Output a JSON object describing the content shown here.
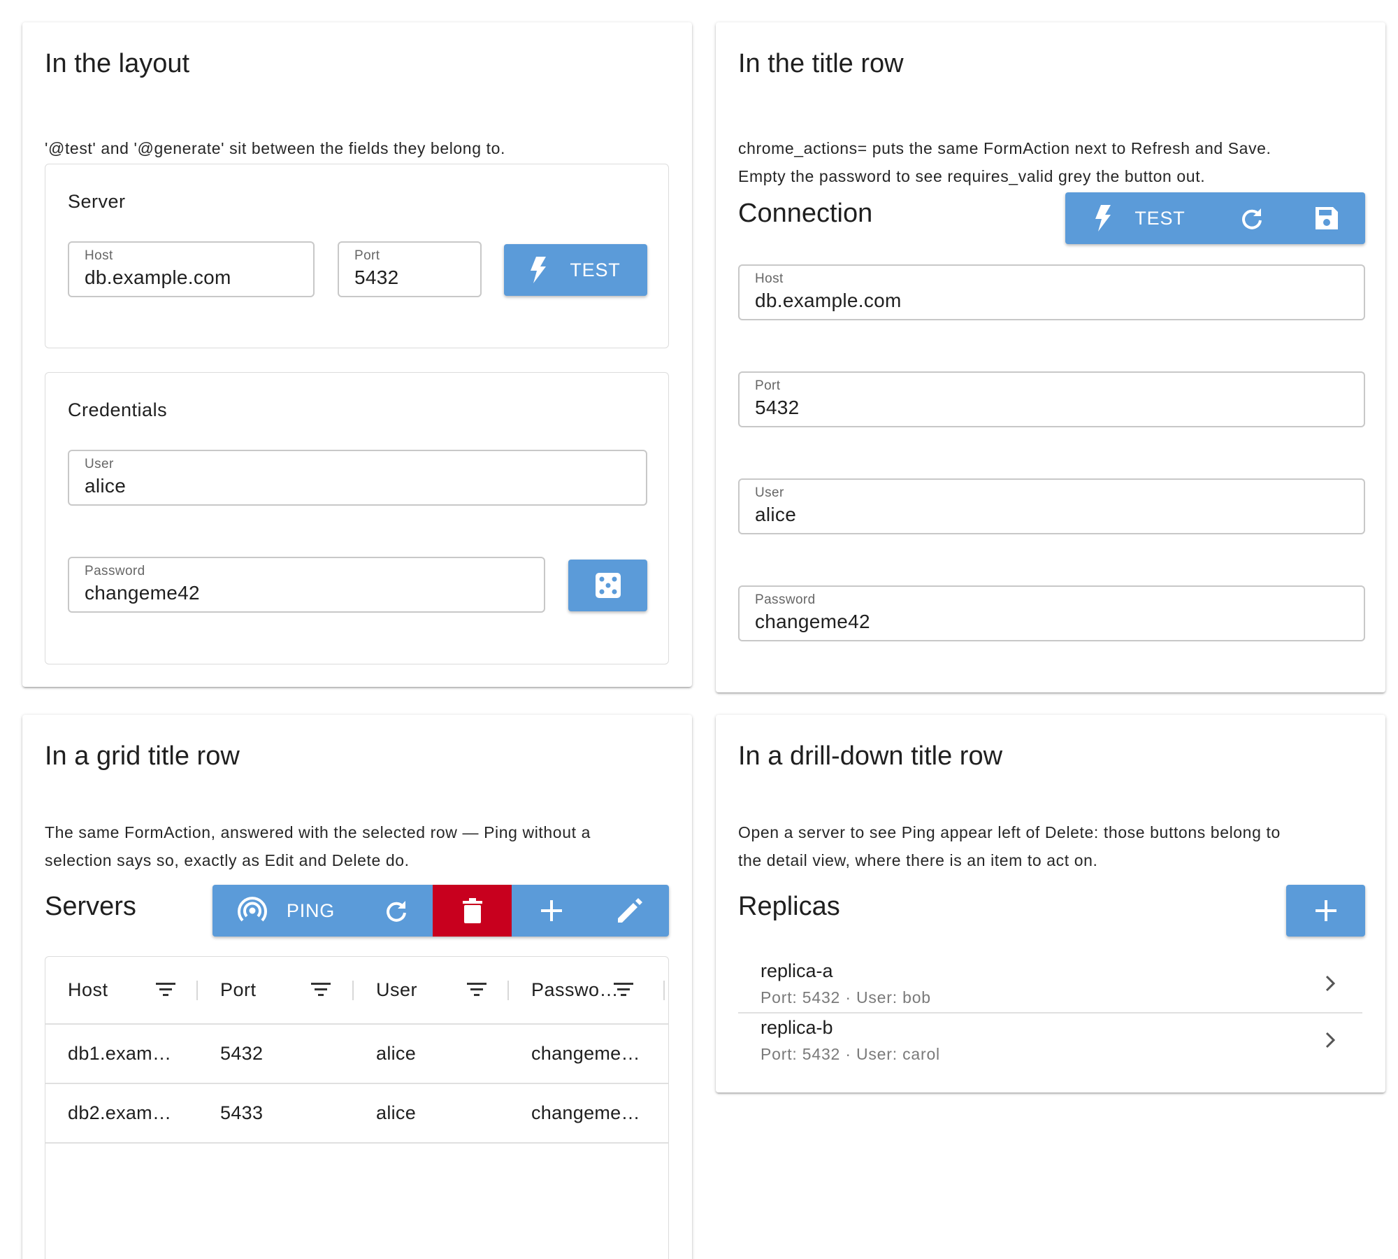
{
  "cards": {
    "layout": {
      "title": "In the layout",
      "desc": "'@test' and '@generate' sit between the fields they belong to.",
      "server": {
        "title": "Server",
        "host_label": "Host",
        "host_value": "db.example.com",
        "port_label": "Port",
        "port_value": "5432",
        "test_label": "TEST"
      },
      "credentials": {
        "title": "Credentials",
        "user_label": "User",
        "user_value": "alice",
        "password_label": "Password",
        "password_value": "changeme42"
      }
    },
    "titlerow": {
      "title": "In the title row",
      "desc1": "chrome_actions= puts the same FormAction next to Refresh and Save.",
      "desc2": "Empty the password to see requires_valid grey the button out.",
      "section": "Connection",
      "test_label": "TEST",
      "host_label": "Host",
      "host_value": "db.example.com",
      "port_label": "Port",
      "port_value": "5432",
      "user_label": "User",
      "user_value": "alice",
      "password_label": "Password",
      "password_value": "changeme42"
    },
    "grid": {
      "title": "In a grid title row",
      "desc1": "The same FormAction, answered with the selected row — Ping without a",
      "desc2": "selection says so, exactly as Edit and Delete do.",
      "section": "Servers",
      "ping_label": "PING",
      "columns": [
        "Host",
        "Port",
        "User",
        "Passwo…"
      ],
      "rows": [
        [
          "db1.exam…",
          "5432",
          "alice",
          "changeme…"
        ],
        [
          "db2.exam…",
          "5433",
          "alice",
          "changeme…"
        ]
      ]
    },
    "drill": {
      "title": "In a drill-down title row",
      "desc1": "Open a server to see Ping appear left of Delete: those buttons belong to",
      "desc2": "the detail view, where there is an item to act on.",
      "section": "Replicas",
      "items": [
        {
          "name": "replica-a",
          "sub": "Port: 5432 · User: bob"
        },
        {
          "name": "replica-b",
          "sub": "Port: 5432 · User: carol"
        }
      ]
    }
  },
  "colors": {
    "primary": "#5b9bd9",
    "danger": "#c8001e",
    "border": "#c8c8c8"
  }
}
